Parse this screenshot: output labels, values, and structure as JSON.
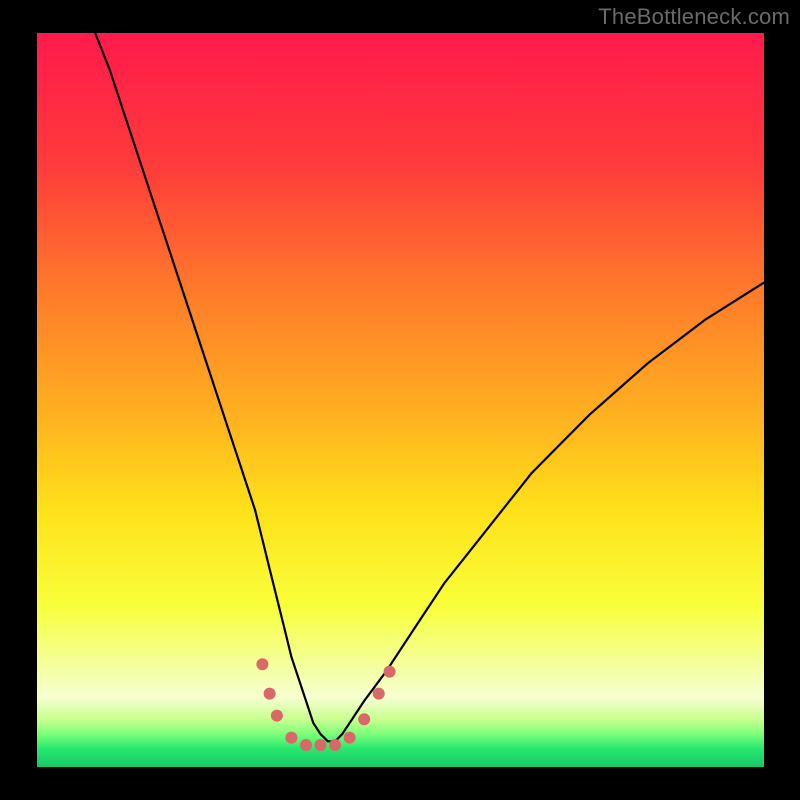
{
  "watermark": "TheBottleneck.com",
  "chart_data": {
    "type": "line",
    "title": "",
    "xlabel": "",
    "ylabel": "",
    "xlim": [
      0,
      100
    ],
    "ylim": [
      0,
      100
    ],
    "background": {
      "type": "vertical-gradient",
      "stops": [
        {
          "offset": 0.0,
          "color": "#ff1a4b"
        },
        {
          "offset": 0.18,
          "color": "#ff3b3b"
        },
        {
          "offset": 0.35,
          "color": "#ff7a2a"
        },
        {
          "offset": 0.52,
          "color": "#ffb020"
        },
        {
          "offset": 0.65,
          "color": "#ffe11a"
        },
        {
          "offset": 0.78,
          "color": "#f8ff3a"
        },
        {
          "offset": 0.86,
          "color": "#f4ff9a"
        },
        {
          "offset": 0.905,
          "color": "#f6ffd0"
        },
        {
          "offset": 0.935,
          "color": "#c8ff90"
        },
        {
          "offset": 0.955,
          "color": "#7dff7a"
        },
        {
          "offset": 0.975,
          "color": "#28e86e"
        },
        {
          "offset": 1.0,
          "color": "#18c767"
        }
      ]
    },
    "series": [
      {
        "name": "bottleneck-curve",
        "color": "#000000",
        "x": [
          8,
          10,
          12,
          14,
          16,
          18,
          20,
          22,
          24,
          26,
          28,
          30,
          31,
          32,
          33,
          34,
          35,
          36,
          37,
          38,
          39,
          40,
          41,
          42,
          43,
          45,
          48,
          52,
          56,
          60,
          64,
          68,
          72,
          76,
          80,
          84,
          88,
          92,
          96,
          100
        ],
        "y": [
          100,
          95,
          89,
          83,
          77,
          71,
          65,
          59,
          53,
          47,
          41,
          35,
          31,
          27,
          23,
          19,
          15,
          12,
          9,
          6,
          4.5,
          3.5,
          3.5,
          4.5,
          6,
          9,
          13,
          19,
          25,
          30,
          35,
          40,
          44,
          48,
          51.5,
          55,
          58,
          61,
          63.5,
          66
        ]
      }
    ],
    "markers": {
      "name": "minimum-markers",
      "color": "#d96868",
      "radius": 6,
      "points": [
        {
          "x": 31,
          "y": 14
        },
        {
          "x": 32,
          "y": 10
        },
        {
          "x": 33,
          "y": 7
        },
        {
          "x": 35,
          "y": 4
        },
        {
          "x": 37,
          "y": 3
        },
        {
          "x": 39,
          "y": 3
        },
        {
          "x": 41,
          "y": 3
        },
        {
          "x": 43,
          "y": 4
        },
        {
          "x": 45,
          "y": 6.5
        },
        {
          "x": 47,
          "y": 10
        },
        {
          "x": 48.5,
          "y": 13
        }
      ]
    }
  }
}
